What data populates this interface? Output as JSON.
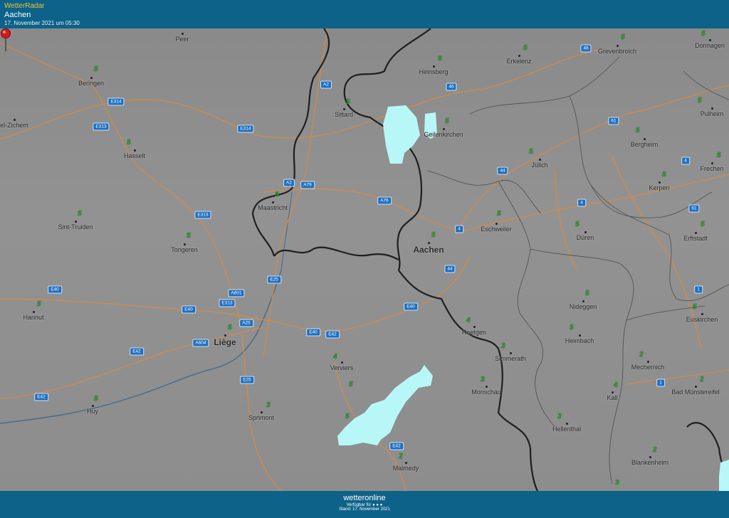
{
  "header": {
    "app_title": "WetterRadar",
    "location": "Aachen",
    "timestamp": "17. November 2021 um 05:30"
  },
  "footer": {
    "brand": "wetteronline",
    "available": "Verfügbar für",
    "stand": "Stand: 17. November 2021"
  },
  "colors": {
    "header_bg": "#0d6289",
    "app_title": "#f0c33a",
    "precipitation": "#b8f7f7",
    "value_green": "#2ea82e",
    "road": "#e08a3c",
    "road_badge": "#1e6fc0",
    "pin": "#d6191b"
  },
  "cities": [
    {
      "name": "Peer",
      "big": false
    },
    {
      "name": "Beringen",
      "big": false
    },
    {
      "name": "el-Zichem",
      "big": false
    },
    {
      "name": "Hasselt",
      "big": false
    },
    {
      "name": "Sittard",
      "big": false
    },
    {
      "name": "Heinsberg",
      "big": false
    },
    {
      "name": "Erkelenz",
      "big": false
    },
    {
      "name": "Grevenbroich",
      "big": false
    },
    {
      "name": "Dormagen",
      "big": false
    },
    {
      "name": "Pulheim",
      "big": false
    },
    {
      "name": "Geilenkirchen",
      "big": false
    },
    {
      "name": "Bergheim",
      "big": false
    },
    {
      "name": "Jülich",
      "big": false
    },
    {
      "name": "Frechen",
      "big": false
    },
    {
      "name": "Kerpen",
      "big": false
    },
    {
      "name": "Maastricht",
      "big": false
    },
    {
      "name": "Sint-Truiden",
      "big": false
    },
    {
      "name": "Tongeren",
      "big": false
    },
    {
      "name": "Aachen",
      "big": true
    },
    {
      "name": "Eschweiler",
      "big": false
    },
    {
      "name": "Düren",
      "big": false
    },
    {
      "name": "Erftstadt",
      "big": false
    },
    {
      "name": "Hannut",
      "big": false
    },
    {
      "name": "Nideggen",
      "big": false
    },
    {
      "name": "Euskirchen",
      "big": false
    },
    {
      "name": "Liège",
      "big": true
    },
    {
      "name": "Roetgen",
      "big": false
    },
    {
      "name": "Heimbach",
      "big": false
    },
    {
      "name": "Verviers",
      "big": false
    },
    {
      "name": "Simmerath",
      "big": false
    },
    {
      "name": "Mechernich",
      "big": false
    },
    {
      "name": "Monschau",
      "big": false
    },
    {
      "name": "Kall",
      "big": false
    },
    {
      "name": "Bad Münstereifel",
      "big": false
    },
    {
      "name": "Huy",
      "big": false
    },
    {
      "name": "Sprimont",
      "big": false
    },
    {
      "name": "Hellenthal",
      "big": false
    },
    {
      "name": "Malmedy",
      "big": false
    },
    {
      "name": "Blankenheim",
      "big": false
    }
  ],
  "values": [
    "5",
    "6",
    "5",
    "5",
    "5",
    "5",
    "5",
    "5",
    "5",
    "5",
    "5",
    "5",
    "5",
    "5",
    "5",
    "5",
    "5",
    "5",
    "5",
    "5",
    "5",
    "5",
    "5",
    "5",
    "5",
    "5",
    "5",
    "5",
    "3",
    "4",
    "3",
    "4",
    "3",
    "2",
    "4",
    "2",
    "3",
    "2",
    "2",
    "3"
  ],
  "roads": [
    "46",
    "A2",
    "46",
    "E314",
    "E313",
    "E314",
    "61",
    "A2",
    "A79",
    "44",
    "4",
    "E313",
    "A76",
    "4",
    "4",
    "61",
    "E25",
    "44",
    "E40",
    "A601",
    "1",
    "E40",
    "E313",
    "E40",
    "A25",
    "E40",
    "E42",
    "A604",
    "E42",
    "E25",
    "1",
    "E42",
    "E42"
  ]
}
